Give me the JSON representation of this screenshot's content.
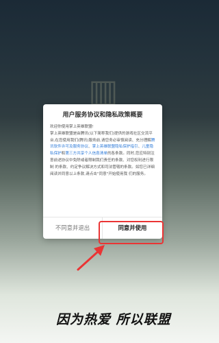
{
  "dialog": {
    "title": "用户服务协议和隐私政策概要",
    "body": {
      "p1": "欢迎你使用掌上英雄联盟!",
      "p2_part1": "掌上英雄联盟是由腾讯(以下简称我们)提供的游戏社区交流平台,在您使用我们(腾讯)服务前,请您务必审慎阅读、充分理解",
      "p2_link1": "腾讯软件许可及服务协议",
      "p2_sep1": "、",
      "p2_link2": "掌上英雄联盟隐私保护指引",
      "p2_sep2": "、",
      "p2_link3": "儿童隐私保护",
      "p2_sep3": "和",
      "p2_link4": "第三方共享个人信息清单",
      "p2_part2": "的各条款。同时,您应特别注意前述协议中免除或者限制我们责任的条款、对您权利进行限制 的条款、约定争议解决方式和司法管辖的条款。如您已详细阅读并同意以上条款,请点击\"同意\"开始使用我 们的服务。"
    },
    "cancel_label": "不同意并退出",
    "confirm_label": "同意并使用"
  },
  "background": {
    "slogan": "因为热爱 所以联盟"
  },
  "annotation": {
    "highlight_color": "#ea3434"
  }
}
